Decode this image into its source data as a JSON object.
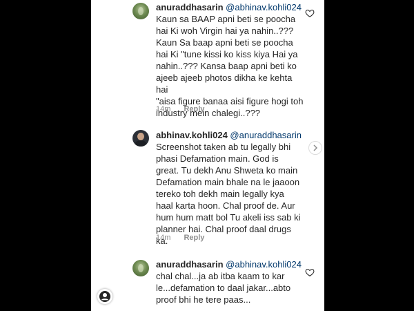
{
  "colors": {
    "text": "#262626",
    "muted": "#8e8e8e",
    "background": "#ffffff",
    "frame": "#000000"
  },
  "comments": [
    {
      "username": "anuraddhasarin",
      "mention": "@abhinav.kohli024",
      "lines": [
        "Kaun sa BAAP apni beti se poocha",
        "hai Ki woh Virgin hai ya nahin..???",
        "Kaun Sa baap apni beti se poocha",
        "hai Ki \"tune kissi ko kiss kiya Hai ya",
        "nahin..??? Kansa baap apni beti ko",
        "ajeeb ajeeb photos dikha ke kehta hai",
        "\"aisa figure banaa aisi figure hogi toh",
        "industry mein chalegi..???"
      ],
      "time": "14m",
      "reply": "Reply",
      "avatar_icon": "leaf-avatar-icon"
    },
    {
      "username": "abhinav.kohli024",
      "mention": "@anuraddhasarin",
      "lines": [
        "Screenshot taken ab tu legally bhi",
        "phasi Defamation main. God is",
        "great. Tu dekh Anu Shweta ko main",
        "Defamation main bhale na le jaaoon",
        "tereko toh dekh main legally kya",
        "haal karta hoon. Chal proof de. Aur",
        "hum hum matt bol Tu akeli iss sab ki",
        "planner hai. Chal proof daal drugs ka."
      ],
      "time": "14m",
      "reply": "Reply",
      "avatar_icon": "person-avatar-icon"
    },
    {
      "username": "anuraddhasarin",
      "mention": "@abhinav.kohli024",
      "lines": [
        "chal chal...ja ab itba kaam to kar",
        "le...defamation to daal jakar...abto",
        "proof bhi he tere paas..."
      ],
      "avatar_icon": "leaf-avatar-icon"
    }
  ],
  "icons": {
    "like": "heart-icon",
    "next": "chevron-right-icon",
    "profile": "profile-icon"
  }
}
